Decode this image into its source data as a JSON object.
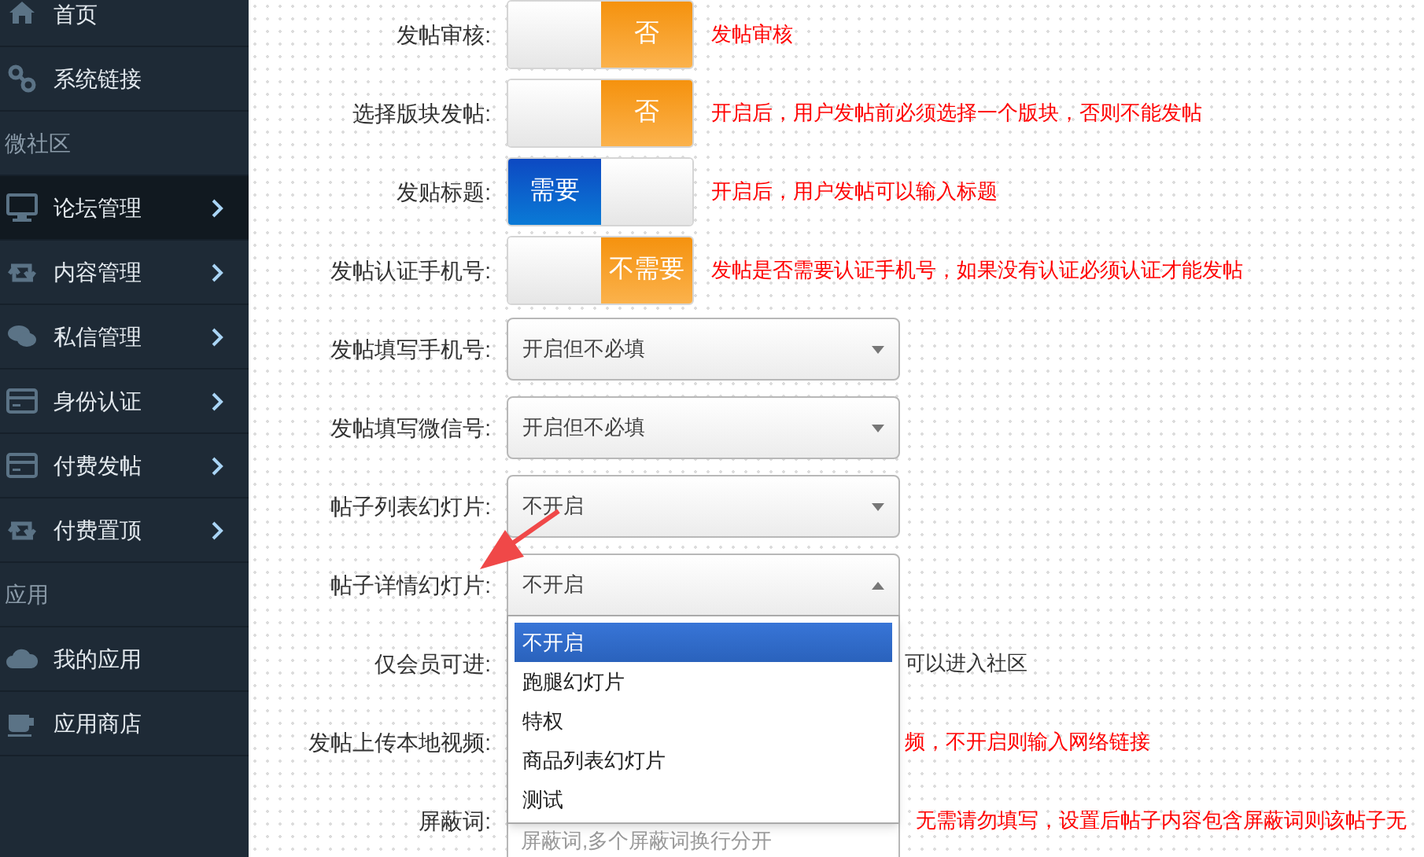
{
  "sidebar": {
    "items": [
      {
        "kind": "item",
        "label": "首页",
        "selected": false,
        "chevron": false
      },
      {
        "kind": "item",
        "label": "系统链接",
        "selected": false,
        "chevron": false
      },
      {
        "kind": "section",
        "label": "微社区"
      },
      {
        "kind": "item",
        "label": "论坛管理",
        "selected": true,
        "chevron": true
      },
      {
        "kind": "item",
        "label": "内容管理",
        "selected": false,
        "chevron": true
      },
      {
        "kind": "item",
        "label": "私信管理",
        "selected": false,
        "chevron": true
      },
      {
        "kind": "item",
        "label": "身份认证",
        "selected": false,
        "chevron": true
      },
      {
        "kind": "item",
        "label": "付费发帖",
        "selected": false,
        "chevron": true
      },
      {
        "kind": "item",
        "label": "付费置顶",
        "selected": false,
        "chevron": true
      },
      {
        "kind": "section",
        "label": "应用"
      },
      {
        "kind": "item",
        "label": "我的应用",
        "selected": false,
        "chevron": false
      },
      {
        "kind": "item",
        "label": "应用商店",
        "selected": false,
        "chevron": false
      }
    ]
  },
  "form": {
    "rows": [
      {
        "kind": "toggle",
        "label": "发帖审核:",
        "on": false,
        "value": "否",
        "hint": "发帖审核"
      },
      {
        "kind": "toggle",
        "label": "选择版块发帖:",
        "on": false,
        "value": "否",
        "hint": "开启后，用户发帖前必须选择一个版块，否则不能发帖"
      },
      {
        "kind": "toggle",
        "label": "发贴标题:",
        "on": true,
        "value": "需要",
        "hint": "开启后，用户发帖可以输入标题"
      },
      {
        "kind": "toggle",
        "label": "发帖认证手机号:",
        "on": false,
        "value": "不需要",
        "hint": "发帖是否需要认证手机号，如果没有认证必须认证才能发帖"
      },
      {
        "kind": "select",
        "label": "发帖填写手机号:",
        "value": "开启但不必填",
        "expanded": false
      },
      {
        "kind": "select",
        "label": "发帖填写微信号:",
        "value": "开启但不必填",
        "expanded": false
      },
      {
        "kind": "select",
        "label": "帖子列表幻灯片:",
        "value": "不开启",
        "expanded": false
      },
      {
        "kind": "select",
        "label": "帖子详情幻灯片:",
        "value": "不开启",
        "expanded": true,
        "options": [
          {
            "label": "不开启",
            "selected": true
          },
          {
            "label": "跑腿幻灯片",
            "selected": false
          },
          {
            "label": "特权",
            "selected": false
          },
          {
            "label": "商品列表幻灯片",
            "selected": false
          },
          {
            "label": "测试",
            "selected": false
          }
        ]
      },
      {
        "kind": "covered_note",
        "label": "仅会员可进:",
        "hint": "可以进入社区"
      },
      {
        "kind": "covered_hint",
        "label": "发帖上传本地视频:",
        "hint": "频，不开启则输入网络链接"
      },
      {
        "kind": "textarea",
        "label": "屏蔽词:",
        "placeholder": "屏蔽词,多个屏蔽词换行分开",
        "hint": "无需请勿填写，设置后帖子内容包含屏蔽词则该帖子无"
      }
    ]
  },
  "annotation": {
    "kind": "arrow"
  }
}
